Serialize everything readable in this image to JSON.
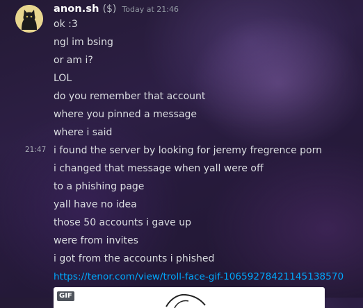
{
  "author": {
    "username": "anon.sh",
    "tag": "($)",
    "timestamp": "Today at 21:46"
  },
  "side_timestamp": "21:47",
  "messages": [
    "ok :3",
    "ngl im bsing",
    "or am i?",
    "LOL",
    "do you remember that account",
    "where you pinned a message",
    "where i said",
    "i found the server by looking for jeremy fregrence porn",
    "i changed that message when yall were off",
    "to a phishing page",
    "yall have no idea",
    "those 50 accounts i gave up",
    "were from invites",
    "i got from the accounts i phished"
  ],
  "link": {
    "text": "https://tenor.com/view/troll-face-gif-10659278421145138570"
  },
  "embed": {
    "badge": "GIF"
  },
  "colors": {
    "link": "#00a8fc",
    "text": "#dbdee1",
    "username": "#ffffff"
  }
}
